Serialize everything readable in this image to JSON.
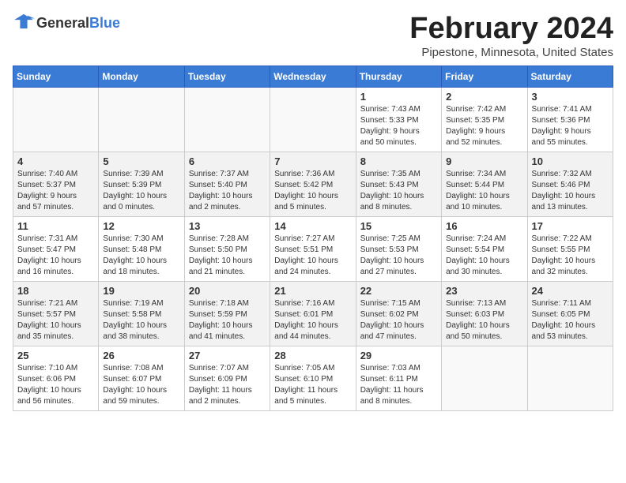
{
  "header": {
    "logo_general": "General",
    "logo_blue": "Blue",
    "month": "February 2024",
    "location": "Pipestone, Minnesota, United States"
  },
  "days_of_week": [
    "Sunday",
    "Monday",
    "Tuesday",
    "Wednesday",
    "Thursday",
    "Friday",
    "Saturday"
  ],
  "weeks": [
    [
      {
        "day": "",
        "info": "",
        "empty": true
      },
      {
        "day": "",
        "info": "",
        "empty": true
      },
      {
        "day": "",
        "info": "",
        "empty": true
      },
      {
        "day": "",
        "info": "",
        "empty": true
      },
      {
        "day": "1",
        "info": "Sunrise: 7:43 AM\nSunset: 5:33 PM\nDaylight: 9 hours\nand 50 minutes."
      },
      {
        "day": "2",
        "info": "Sunrise: 7:42 AM\nSunset: 5:35 PM\nDaylight: 9 hours\nand 52 minutes."
      },
      {
        "day": "3",
        "info": "Sunrise: 7:41 AM\nSunset: 5:36 PM\nDaylight: 9 hours\nand 55 minutes."
      }
    ],
    [
      {
        "day": "4",
        "info": "Sunrise: 7:40 AM\nSunset: 5:37 PM\nDaylight: 9 hours\nand 57 minutes."
      },
      {
        "day": "5",
        "info": "Sunrise: 7:39 AM\nSunset: 5:39 PM\nDaylight: 10 hours\nand 0 minutes."
      },
      {
        "day": "6",
        "info": "Sunrise: 7:37 AM\nSunset: 5:40 PM\nDaylight: 10 hours\nand 2 minutes."
      },
      {
        "day": "7",
        "info": "Sunrise: 7:36 AM\nSunset: 5:42 PM\nDaylight: 10 hours\nand 5 minutes."
      },
      {
        "day": "8",
        "info": "Sunrise: 7:35 AM\nSunset: 5:43 PM\nDaylight: 10 hours\nand 8 minutes."
      },
      {
        "day": "9",
        "info": "Sunrise: 7:34 AM\nSunset: 5:44 PM\nDaylight: 10 hours\nand 10 minutes."
      },
      {
        "day": "10",
        "info": "Sunrise: 7:32 AM\nSunset: 5:46 PM\nDaylight: 10 hours\nand 13 minutes."
      }
    ],
    [
      {
        "day": "11",
        "info": "Sunrise: 7:31 AM\nSunset: 5:47 PM\nDaylight: 10 hours\nand 16 minutes."
      },
      {
        "day": "12",
        "info": "Sunrise: 7:30 AM\nSunset: 5:48 PM\nDaylight: 10 hours\nand 18 minutes."
      },
      {
        "day": "13",
        "info": "Sunrise: 7:28 AM\nSunset: 5:50 PM\nDaylight: 10 hours\nand 21 minutes."
      },
      {
        "day": "14",
        "info": "Sunrise: 7:27 AM\nSunset: 5:51 PM\nDaylight: 10 hours\nand 24 minutes."
      },
      {
        "day": "15",
        "info": "Sunrise: 7:25 AM\nSunset: 5:53 PM\nDaylight: 10 hours\nand 27 minutes."
      },
      {
        "day": "16",
        "info": "Sunrise: 7:24 AM\nSunset: 5:54 PM\nDaylight: 10 hours\nand 30 minutes."
      },
      {
        "day": "17",
        "info": "Sunrise: 7:22 AM\nSunset: 5:55 PM\nDaylight: 10 hours\nand 32 minutes."
      }
    ],
    [
      {
        "day": "18",
        "info": "Sunrise: 7:21 AM\nSunset: 5:57 PM\nDaylight: 10 hours\nand 35 minutes."
      },
      {
        "day": "19",
        "info": "Sunrise: 7:19 AM\nSunset: 5:58 PM\nDaylight: 10 hours\nand 38 minutes."
      },
      {
        "day": "20",
        "info": "Sunrise: 7:18 AM\nSunset: 5:59 PM\nDaylight: 10 hours\nand 41 minutes."
      },
      {
        "day": "21",
        "info": "Sunrise: 7:16 AM\nSunset: 6:01 PM\nDaylight: 10 hours\nand 44 minutes."
      },
      {
        "day": "22",
        "info": "Sunrise: 7:15 AM\nSunset: 6:02 PM\nDaylight: 10 hours\nand 47 minutes."
      },
      {
        "day": "23",
        "info": "Sunrise: 7:13 AM\nSunset: 6:03 PM\nDaylight: 10 hours\nand 50 minutes."
      },
      {
        "day": "24",
        "info": "Sunrise: 7:11 AM\nSunset: 6:05 PM\nDaylight: 10 hours\nand 53 minutes."
      }
    ],
    [
      {
        "day": "25",
        "info": "Sunrise: 7:10 AM\nSunset: 6:06 PM\nDaylight: 10 hours\nand 56 minutes."
      },
      {
        "day": "26",
        "info": "Sunrise: 7:08 AM\nSunset: 6:07 PM\nDaylight: 10 hours\nand 59 minutes."
      },
      {
        "day": "27",
        "info": "Sunrise: 7:07 AM\nSunset: 6:09 PM\nDaylight: 11 hours\nand 2 minutes."
      },
      {
        "day": "28",
        "info": "Sunrise: 7:05 AM\nSunset: 6:10 PM\nDaylight: 11 hours\nand 5 minutes."
      },
      {
        "day": "29",
        "info": "Sunrise: 7:03 AM\nSunset: 6:11 PM\nDaylight: 11 hours\nand 8 minutes."
      },
      {
        "day": "",
        "info": "",
        "empty": true
      },
      {
        "day": "",
        "info": "",
        "empty": true
      }
    ]
  ]
}
